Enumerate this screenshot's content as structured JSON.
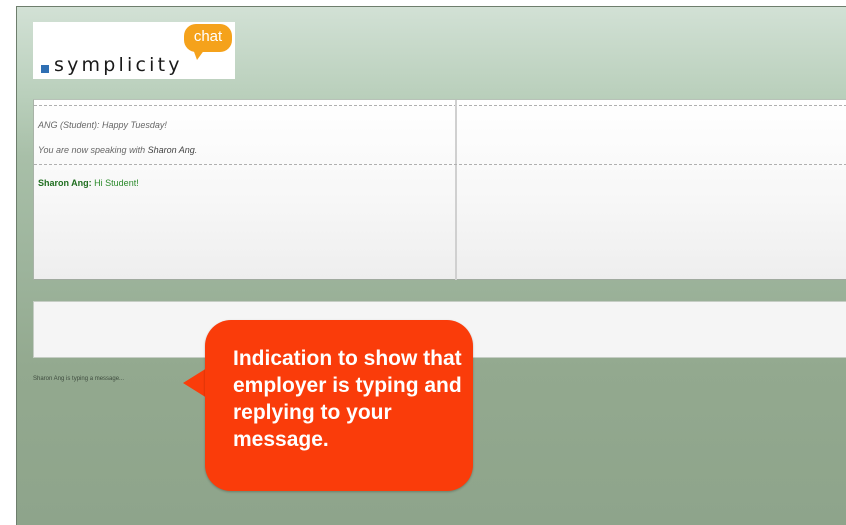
{
  "logo": {
    "wordmark": "symplicity",
    "bubble_text": "chat",
    "colors": {
      "square": "#2f6fb3",
      "bubble": "#f5a21b"
    }
  },
  "chat": {
    "messages": [
      {
        "text": "ANG (Student): Happy Tuesday!"
      },
      {
        "prefix": "You are now speaking with ",
        "name": "Sharon Ang",
        "suffix": "."
      },
      {
        "sender": "Sharon Ang:",
        "text": " Hi Student!"
      }
    ]
  },
  "input": {
    "value": ""
  },
  "status": {
    "typing_text": "Sharon Ang is typing a message..."
  },
  "callout": {
    "text": "Indication to show that employer is typing and replying to your message.",
    "color": "#fa3c0a"
  }
}
